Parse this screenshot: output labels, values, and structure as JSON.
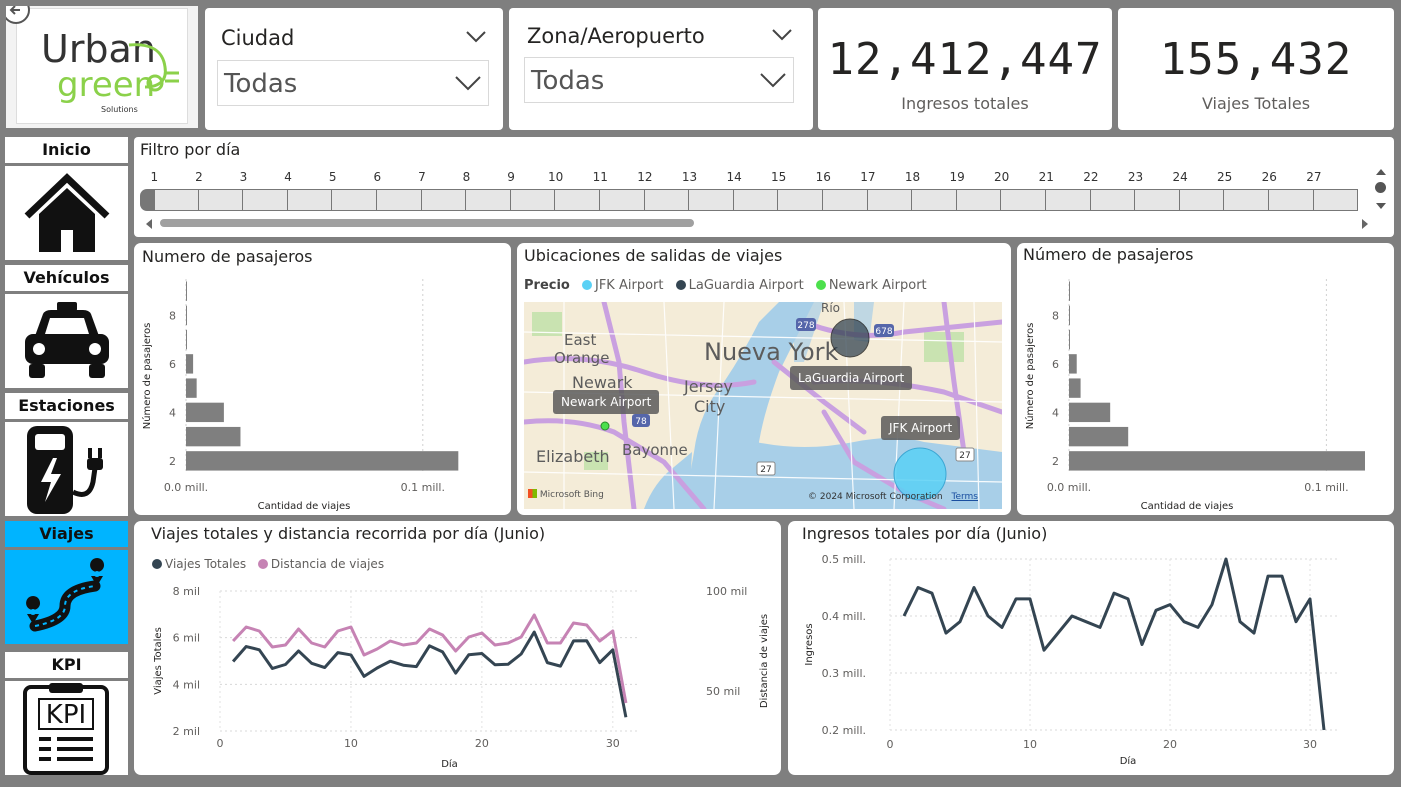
{
  "logo": {
    "line1": "Urban",
    "line2": "green",
    "line3": "Solutions"
  },
  "filters": {
    "ciudad": {
      "label": "Ciudad",
      "value": "Todas"
    },
    "zona": {
      "label": "Zona/Aeropuerto",
      "value": "Todas"
    }
  },
  "kpis": [
    {
      "value": "12,412,447",
      "label": "Ingresos totales"
    },
    {
      "value": "155,432",
      "label": "Viajes Totales"
    }
  ],
  "nav": {
    "items": [
      "Inicio",
      "Vehículos",
      "Estaciones",
      "Viajes",
      "KPI"
    ],
    "active": "Viajes",
    "active_color": "#00b4ff"
  },
  "day_filter": {
    "title": "Filtro por día",
    "days": [
      "1",
      "2",
      "3",
      "4",
      "5",
      "6",
      "7",
      "8",
      "9",
      "10",
      "11",
      "12",
      "13",
      "14",
      "15",
      "16",
      "17",
      "18",
      "19",
      "20",
      "21",
      "22",
      "23",
      "24",
      "25",
      "26",
      "27"
    ]
  },
  "passengers_left": {
    "title": "Numero de pasajeros",
    "chart_data": {
      "type": "bar",
      "orientation": "horizontal",
      "categories": [
        "2",
        "3",
        "4",
        "5",
        "6",
        "7",
        "8",
        "9"
      ],
      "values": [
        115000,
        23000,
        16000,
        4500,
        3000,
        300,
        300,
        200
      ],
      "ylabel": "Número de pasajeros",
      "xlabel": "Cantidad de viajes",
      "y_tick_labels": [
        "2",
        "4",
        "6",
        "8"
      ],
      "x_tick_labels": [
        "0.0 mill.",
        "0.1 mill."
      ],
      "xlim": [
        0,
        125000
      ],
      "color": "#7f7f7f"
    }
  },
  "map": {
    "title": "Ubicaciones de salidas de viajes",
    "legend_title": "Precio",
    "legend": [
      {
        "name": "JFK Airport",
        "color": "#5ad1f5"
      },
      {
        "name": "LaGuardia Airport",
        "color": "#344552"
      },
      {
        "name": "Newark Airport",
        "color": "#4ce04c"
      }
    ],
    "places": [
      "East Orange",
      "Newark",
      "Jersey City",
      "Nueva York",
      "Elizabeth",
      "Bayonne",
      "Rio"
    ],
    "labels": [
      "Newark Airport",
      "LaGuardia Airport",
      "JFK Airport"
    ],
    "copyright": "© 2024 Microsoft Corporation",
    "terms": "Terms",
    "bing": "Microsoft Bing",
    "route_shields": [
      "78",
      "278",
      "27",
      "27",
      "678"
    ]
  },
  "passengers_right": {
    "title": "Número de pasajeros",
    "chart_data": {
      "type": "bar",
      "orientation": "horizontal",
      "categories": [
        "2",
        "3",
        "4",
        "5",
        "6",
        "7",
        "8",
        "9"
      ],
      "values": [
        115000,
        23000,
        16000,
        4500,
        3000,
        300,
        300,
        200
      ],
      "ylabel": "Número de pasajeros",
      "xlabel": "Cantidad de viajes",
      "y_tick_labels": [
        "2",
        "4",
        "6",
        "8"
      ],
      "x_tick_labels": [
        "0.0 mill.",
        "0.1 mill."
      ],
      "xlim": [
        0,
        115000
      ],
      "color": "#7f7f7f"
    }
  },
  "trips_distance": {
    "title": "Viajes totales y distancia recorrida por día (Junio)",
    "chart_data": {
      "type": "line",
      "x": [
        1,
        2,
        3,
        4,
        5,
        6,
        7,
        8,
        9,
        10,
        11,
        12,
        13,
        14,
        15,
        16,
        17,
        18,
        19,
        20,
        21,
        22,
        23,
        24,
        25,
        26,
        27,
        28,
        29,
        30,
        31
      ],
      "series": [
        {
          "name": "Viajes Totales",
          "axis": "left",
          "color": "#344552",
          "values": [
            4980,
            5620,
            5480,
            4680,
            4850,
            5430,
            4900,
            4720,
            5360,
            5260,
            4340,
            4700,
            4990,
            4820,
            4760,
            5650,
            5390,
            4480,
            5270,
            5320,
            4840,
            4860,
            5300,
            6240,
            4930,
            4780,
            5860,
            5870,
            4930,
            5480,
            2590
          ]
        },
        {
          "name": "Distancia de viajes",
          "axis": "right",
          "color": "#c683b4",
          "values": [
            75,
            82,
            80,
            72,
            73,
            81,
            74,
            72,
            80,
            82,
            68,
            71,
            75,
            73,
            74,
            81,
            78,
            70,
            77,
            79,
            73,
            74,
            77,
            88,
            74,
            74,
            84,
            83,
            75,
            80,
            44
          ]
        }
      ],
      "xlabel": "Día",
      "ylabel_left": "Viajes Totales",
      "ylabel_right": "Distancia de viajes",
      "left_ticks": [
        "2 mil",
        "4 mil",
        "6 mil",
        "8 mil"
      ],
      "right_ticks": [
        "50 mil",
        "100 mil"
      ],
      "x_ticks": [
        "0",
        "10",
        "20",
        "30"
      ],
      "ylim_left": [
        2000,
        8000
      ],
      "ylim_right": [
        30000,
        100000
      ],
      "right_units": "thousands"
    }
  },
  "revenue": {
    "title": "Ingresos totales por día (Junio)",
    "chart_data": {
      "type": "line",
      "x": [
        1,
        2,
        3,
        4,
        5,
        6,
        7,
        8,
        9,
        10,
        11,
        12,
        13,
        14,
        15,
        16,
        17,
        18,
        19,
        20,
        21,
        22,
        23,
        24,
        25,
        26,
        27,
        28,
        29,
        30,
        31
      ],
      "series": [
        {
          "name": "Ingresos",
          "color": "#344552",
          "values": [
            0.4,
            0.45,
            0.44,
            0.37,
            0.39,
            0.45,
            0.4,
            0.38,
            0.43,
            0.43,
            0.34,
            0.37,
            0.4,
            0.39,
            0.38,
            0.44,
            0.43,
            0.35,
            0.41,
            0.42,
            0.39,
            0.38,
            0.42,
            0.5,
            0.39,
            0.37,
            0.47,
            0.47,
            0.39,
            0.43,
            0.2
          ]
        }
      ],
      "xlabel": "Día",
      "ylabel": "Ingresos",
      "y_ticks": [
        "0.2 mill.",
        "0.3 mill.",
        "0.4 mill.",
        "0.5 mill."
      ],
      "x_ticks": [
        "0",
        "10",
        "20",
        "30"
      ],
      "ylim": [
        0.2,
        0.5
      ]
    }
  }
}
